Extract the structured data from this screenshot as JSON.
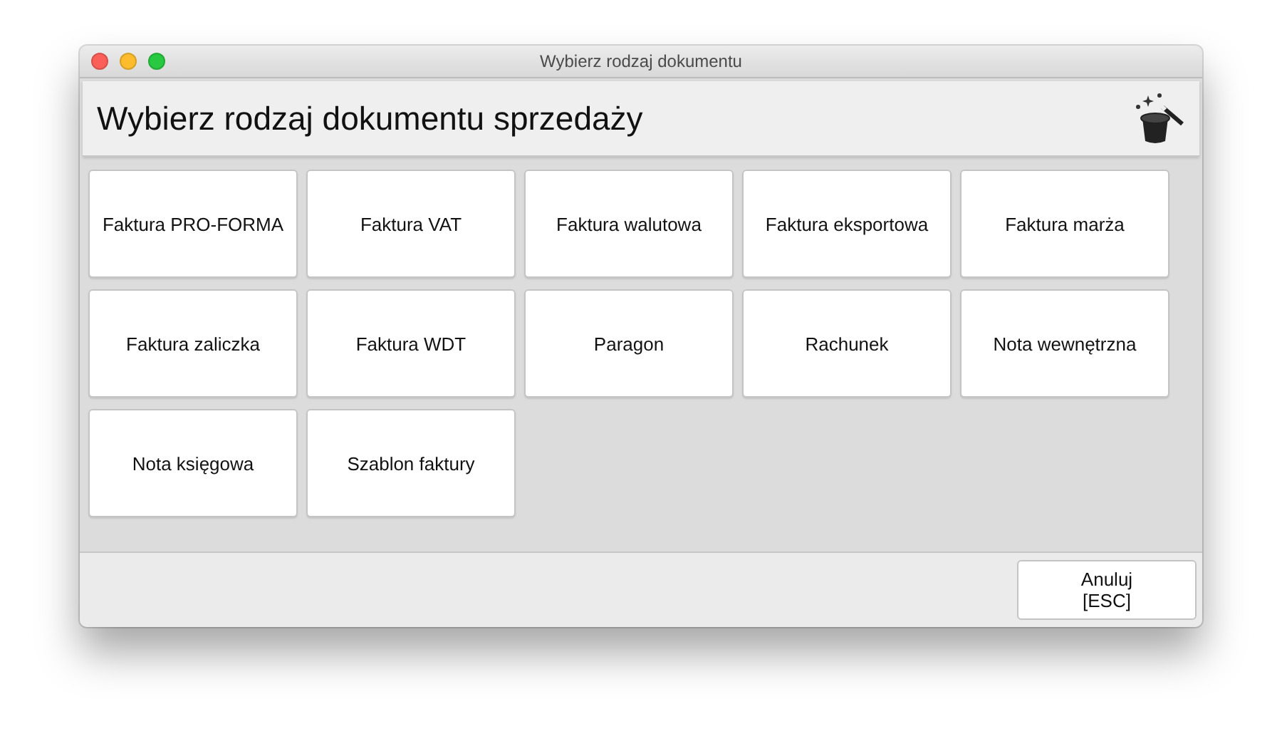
{
  "window": {
    "title": "Wybierz rodzaj dokumentu"
  },
  "header": {
    "title": "Wybierz rodzaj dokumentu sprzedaży"
  },
  "documents": [
    "Faktura PRO-FORMA",
    "Faktura VAT",
    "Faktura walutowa",
    "Faktura eksportowa",
    "Faktura marża",
    "Faktura zaliczka",
    "Faktura WDT",
    "Paragon",
    "Rachunek",
    "Nota wewnętrzna",
    "Nota księgowa",
    "Szablon faktury"
  ],
  "buttons": [
    {
      "label": "Anuluj\n[ESC]"
    }
  ]
}
